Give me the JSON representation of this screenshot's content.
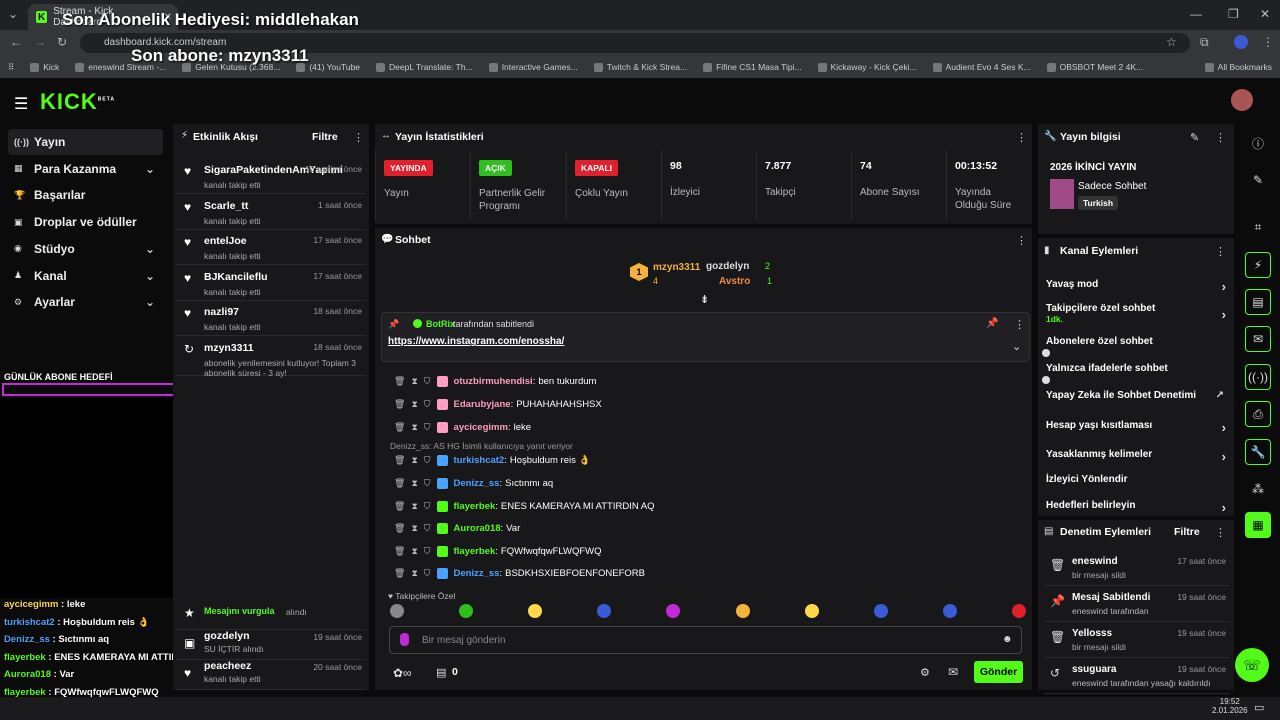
{
  "browser": {
    "tab_title": "Stream - Kick Dashboard",
    "url": "dashboard.kick.com/stream",
    "bookmarks": [
      "Kick",
      "eneswind Stream -...",
      "Gelen Kutusu (2.368...",
      "(41) YouTube",
      "DeepL Translate: Th...",
      "Interactive Games...",
      "Twitch & Kick Strea...",
      "Fifine CS1 Masa Tipi...",
      "Kickaway - Kick Çeki...",
      "Audient Evo 4 Ses K...",
      "OBSBOT Meet 2 4K..."
    ],
    "all_bookmarks": "All Bookmarks"
  },
  "overlay": {
    "gift": "Son Abonelik Hediyesi: middlehakan",
    "last_sub": "Son abone: mzyn3311",
    "goal_label": "GÜNLÜK ABONE HEDEFİ"
  },
  "header": {
    "logo": "KICK",
    "logo_beta": "BETA"
  },
  "nav": [
    {
      "label": "Yayın",
      "icon": "broadcast-icon"
    },
    {
      "label": "Para Kazanma",
      "icon": "money-icon"
    },
    {
      "label": "Başarılar",
      "icon": "trophy-icon"
    },
    {
      "label": "Droplar ve ödüller",
      "icon": "gift-icon"
    },
    {
      "label": "Stüdyo",
      "icon": "studio-icon"
    },
    {
      "label": "Kanal",
      "icon": "user-icon"
    },
    {
      "label": "Ayarlar",
      "icon": "gear-icon"
    }
  ],
  "feed": {
    "title": "Etkinlik Akışı",
    "filter": "Filtre",
    "items": [
      {
        "name": "SigaraPaketindenAmYapimi",
        "sub": "kanalı takip etti",
        "time": "10 saniye önce"
      },
      {
        "name": "Scarle_tt",
        "sub": "kanalı takip etti",
        "time": "1 saat önce"
      },
      {
        "name": "entelJoe",
        "sub": "kanalı takip etti",
        "time": "17 saat önce"
      },
      {
        "name": "BJKancileflu",
        "sub": "kanalı takip etti",
        "time": "17 saat önce"
      },
      {
        "name": "nazli97",
        "sub": "kanalı takip etti",
        "time": "18 saat önce"
      },
      {
        "name": "mzyn3311",
        "sub": "abonelik yenilemesini kutluyor! Toplam 3",
        "sub2": "abonelik süresi - 3 ay!",
        "time": "18 saat önce"
      }
    ],
    "bottom": [
      {
        "name": "Mesajını vurgula",
        "sub": "alındı"
      },
      {
        "name": "gozdelyn",
        "sub": "SU İÇTİR alındı",
        "time": "19 saat önce"
      },
      {
        "name": "peacheez",
        "sub": "kanalı takip etti",
        "time": "20 saat önce"
      }
    ]
  },
  "stats": {
    "title": "Yayın İstatistikleri",
    "cols": [
      {
        "badge": "YAYINDA",
        "color": "#e2202c",
        "label": "Yayın"
      },
      {
        "badge": "AÇIK",
        "color": "#2fbf1e",
        "label": "Partnerlik Gelir Programı"
      },
      {
        "badge": "KAPALI",
        "color": "#e2202c",
        "label": "Çoklu Yayın"
      },
      {
        "value": "98",
        "label": "İzleyici"
      },
      {
        "value": "7.877",
        "label": "Takipçi"
      },
      {
        "value": "74",
        "label": "Abone Sayısı"
      },
      {
        "value": "00:13:52",
        "label": "Yayında Olduğu Süre"
      }
    ]
  },
  "chat": {
    "title": "Sohbet",
    "top": [
      {
        "name": "mzyn3311",
        "count": "4"
      },
      {
        "name": "gozdelyn",
        "count": "2"
      },
      {
        "name": "Avstro",
        "count": "1"
      }
    ],
    "pinned_by": "BotRix",
    "pinned_suffix": "tarafından sabitlendi",
    "pinned_link": "https://www.instagram.com/enossha/",
    "reply_note": "Denizz_ss: AS HG İsimli kullanıcıya yanıt veriyor",
    "messages": [
      {
        "user": "otuzbirmuhendisi",
        "color": "#ff9dc2",
        "text": "ben tukurdum"
      },
      {
        "user": "Edarubyjane",
        "color": "#ff9dc2",
        "text": "PUHAHAHAHSHSX"
      },
      {
        "user": "aycicegimm",
        "color": "#ff9dc2",
        "text": "leke"
      },
      {
        "user": "turkishcat2",
        "color": "#4aa3ff",
        "text": "Hoşbuldum reis 👌"
      },
      {
        "user": "Denizz_ss",
        "color": "#4aa3ff",
        "text": "Sıctınmı aq"
      },
      {
        "user": "flayerbek",
        "color": "#53fc18",
        "text": "ENES KAMERAYA MI ATTIRDIN AQ"
      },
      {
        "user": "Aurora018",
        "color": "#53fc18",
        "text": "Var"
      },
      {
        "user": "flayerbek",
        "color": "#53fc18",
        "text": "FQWfwqfqwFLWQFWQ"
      },
      {
        "user": "Denizz_ss",
        "color": "#4aa3ff",
        "text": "BSDKHSXIEBFOENFONEFORB"
      }
    ],
    "followers_only": "Takipçilere Özel",
    "placeholder": "Bir mesaj gönderin",
    "points": "0",
    "send": "Gönder"
  },
  "info": {
    "title": "Yayın bilgisi",
    "stream_title": "2026 İKİNCİ YAYIN",
    "category": "Sadece Sohbet",
    "lang": "Turkish"
  },
  "actions": {
    "title": "Kanal Eylemleri",
    "items": [
      {
        "label": "Yavaş mod",
        "type": "chev"
      },
      {
        "label": "Takipçilere özel sohbet",
        "sub": "1dk.",
        "type": "chev"
      },
      {
        "label": "Abonelere özel sohbet",
        "type": "toggle"
      },
      {
        "label": "Yalnızca ifadelerle sohbet",
        "type": "toggle"
      },
      {
        "label": "Yapay Zeka ile Sohbet Denetimi",
        "type": "ext"
      },
      {
        "label": "Hesap yaşı kısıtlaması",
        "type": "chev"
      },
      {
        "label": "Yasaklanmış kelimeler",
        "type": "chev"
      },
      {
        "label": "İzleyici Yönlendir",
        "type": "none"
      },
      {
        "label": "Hedefleri belirleyin",
        "type": "chev"
      }
    ]
  },
  "mod": {
    "title": "Denetim Eylemleri",
    "filter": "Filtre",
    "items": [
      {
        "name": "eneswind",
        "sub": "bir mesajı sildi",
        "time": "17 saat önce",
        "icon": "trash-icon"
      },
      {
        "name": "Mesaj Sabitlendi",
        "sub": "eneswind tarafından",
        "time": "19 saat önce",
        "icon": "pin-icon"
      },
      {
        "name": "Yellosss",
        "sub": "bir mesajı sildi",
        "time": "19 saat önce",
        "icon": "trash-icon"
      },
      {
        "name": "ssuguara",
        "sub": "eneswind tarafından yasağı kaldırıldı",
        "time": "19 saat önce",
        "icon": "undo-icon"
      }
    ]
  },
  "overlay_chat": [
    {
      "user": "aycicegimm",
      "color": "#ffd84a",
      "text": "leke"
    },
    {
      "user": "turkishcat2",
      "color": "#4aa3ff",
      "text": "Hoşbuldum reis 👌"
    },
    {
      "user": "Denizz_ss",
      "color": "#4aa3ff",
      "text": "Sıctınmı aq"
    },
    {
      "user": "flayerbek",
      "color": "#53fc18",
      "text": "ENES KAMERAYA MI ATTIRDIN AQ"
    },
    {
      "user": "Aurora018",
      "color": "#53fc18",
      "text": "Var"
    },
    {
      "user": "flayerbek",
      "color": "#53fc18",
      "text": "FQWfwqfqwFLWQFWQ"
    },
    {
      "user": "Denizz_ss",
      "color": "#4aa3ff",
      "text": "BSDKHSXIEBFOENFONEFORB"
    }
  ],
  "taskbar": {
    "time": "19:52",
    "date": "2.01.2026"
  }
}
